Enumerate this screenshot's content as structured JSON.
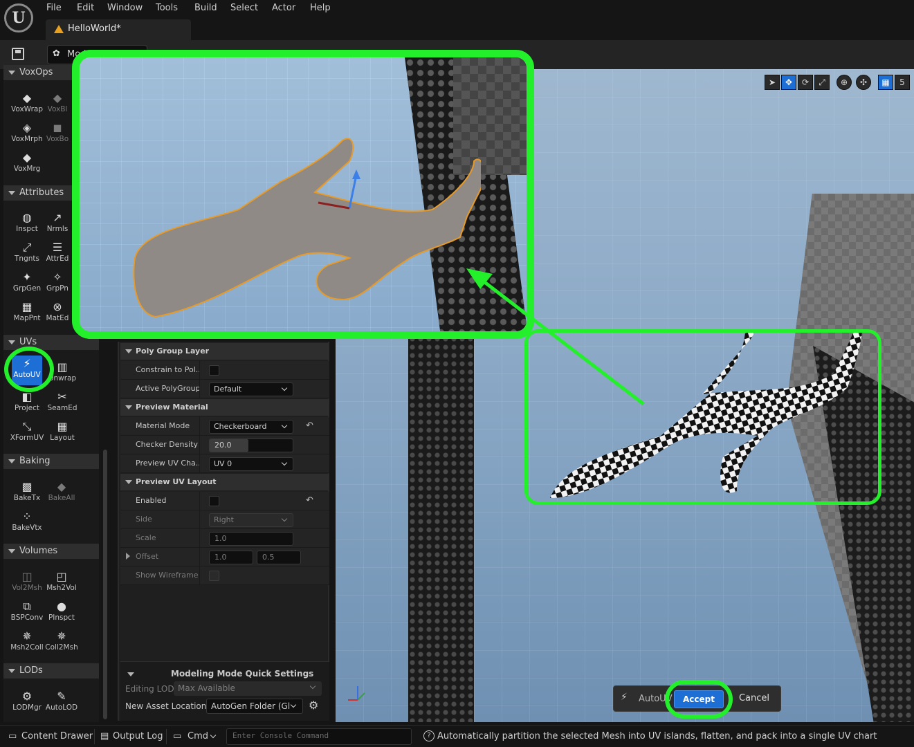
{
  "menubar": {
    "items": [
      "File",
      "Edit",
      "Window",
      "Tools",
      "Build",
      "Select",
      "Actor",
      "Help"
    ],
    "document_tab": "HelloWorld*"
  },
  "toolbar": {
    "mode_label": "Mod"
  },
  "palette": {
    "sections": [
      {
        "title": "VoxOps",
        "tools": [
          "VoxWrap",
          "VoxBl",
          "VoxMrph",
          "VoxBo",
          "VoxMrg"
        ]
      },
      {
        "title": "Attributes",
        "tools": [
          "Inspct",
          "Nrmls",
          "Tngnts",
          "AttrEd",
          "GrpGen",
          "GrpPn",
          "MapPnt",
          "MatEd"
        ]
      },
      {
        "title": "UVs",
        "tools": [
          "AutoUV",
          "Unwrap",
          "Project",
          "SeamEd",
          "XFormUV",
          "Layout"
        ]
      },
      {
        "title": "Baking",
        "tools": [
          "BakeTx",
          "BakeAll",
          "BakeVtx"
        ]
      },
      {
        "title": "Volumes",
        "tools": [
          "Vol2Msh",
          "Msh2Vol",
          "BSPConv",
          "PInspct",
          "Msh2Coll",
          "Coll2Msh"
        ]
      },
      {
        "title": "LODs",
        "tools": [
          "LODMgr",
          "AutoLOD"
        ]
      }
    ]
  },
  "details": {
    "poly_group_layer": {
      "title": "Poly Group Layer",
      "constrain_label": "Constrain to Pol...",
      "active_polygroup_label": "Active PolyGroup",
      "active_polygroup_value": "Default"
    },
    "preview_material": {
      "title": "Preview Material",
      "material_mode_label": "Material Mode",
      "material_mode_value": "Checkerboard",
      "checker_density_label": "Checker Density",
      "checker_density_value": "20.0",
      "preview_uv_channel_label": "Preview UV Cha...",
      "preview_uv_channel_value": "UV 0"
    },
    "preview_uv_layout": {
      "title": "Preview UV Layout",
      "enabled_label": "Enabled",
      "side_label": "Side",
      "side_value": "Right",
      "scale_label": "Scale",
      "scale_value": "1.0",
      "offset_label": "Offset",
      "offset_x": "1.0",
      "offset_y": "0.5",
      "show_wireframe_label": "Show Wireframe"
    },
    "quick_settings": {
      "title": "Modeling Mode Quick Settings",
      "editing_lod_label": "Editing LOD",
      "editing_lod_value": "Max Available",
      "new_asset_location_label": "New Asset Location",
      "new_asset_location_value": "AutoGen Folder (Gl"
    }
  },
  "viewport": {
    "grid_snap_value": "5"
  },
  "accept_bar": {
    "tool_name": "AutoUV",
    "accept_label": "Accept",
    "cancel_label": "Cancel"
  },
  "statusbar": {
    "content_drawer": "Content Drawer",
    "output_log": "Output Log",
    "cmd": "Cmd",
    "console_placeholder": "Enter Console Command",
    "message": "Automatically partition the selected Mesh into UV islands, flatten, and pack into a single UV chart"
  },
  "colors": {
    "accent": "#1d6fd6",
    "highlight_green": "#23f02a",
    "selection_outline": "#e8a020"
  }
}
